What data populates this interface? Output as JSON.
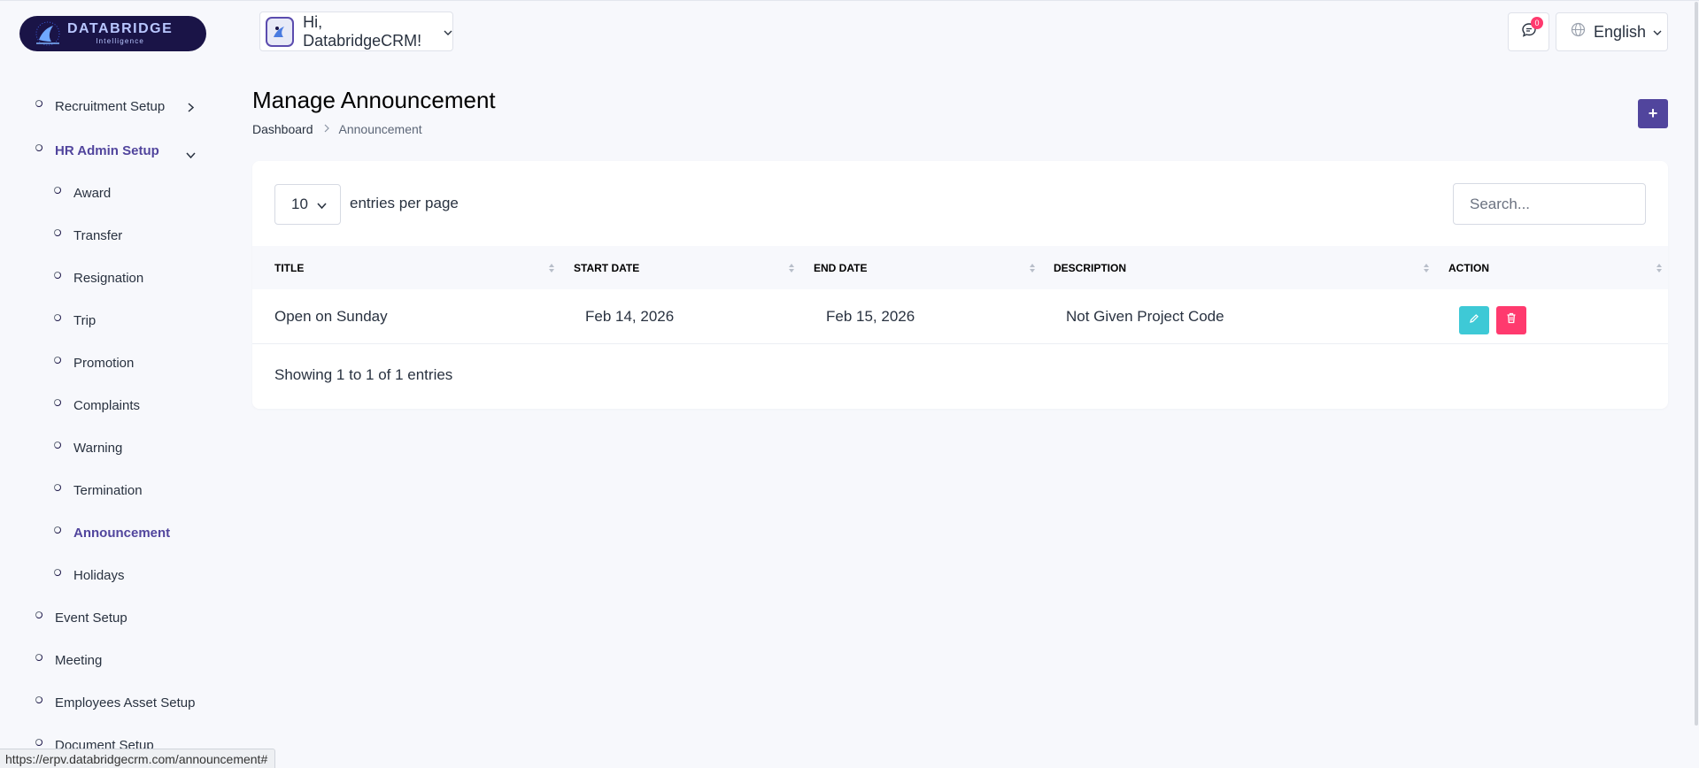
{
  "header": {
    "logo": {
      "title": "DATABRIDGE",
      "subtitle": "Intelligence"
    },
    "user_greeting": "Hi, DatabridgeCRM!",
    "notification_count": "0",
    "language": "English"
  },
  "sidebar": {
    "items": [
      {
        "label": "Recruitment Setup",
        "level": 1,
        "expandable": true,
        "expanded": false
      },
      {
        "label": "HR Admin Setup",
        "level": 1,
        "expandable": true,
        "expanded": true,
        "active": true
      },
      {
        "label": "Award",
        "level": 2
      },
      {
        "label": "Transfer",
        "level": 2
      },
      {
        "label": "Resignation",
        "level": 2
      },
      {
        "label": "Trip",
        "level": 2
      },
      {
        "label": "Promotion",
        "level": 2
      },
      {
        "label": "Complaints",
        "level": 2
      },
      {
        "label": "Warning",
        "level": 2
      },
      {
        "label": "Termination",
        "level": 2
      },
      {
        "label": "Announcement",
        "level": 2,
        "active": true
      },
      {
        "label": "Holidays",
        "level": 2
      },
      {
        "label": "Event Setup",
        "level": 1
      },
      {
        "label": "Meeting",
        "level": 1
      },
      {
        "label": "Employees Asset Setup",
        "level": 1
      },
      {
        "label": "Document Setup",
        "level": 1
      }
    ]
  },
  "main": {
    "title": "Manage Announcement",
    "breadcrumb": {
      "home": "Dashboard",
      "current": "Announcement"
    },
    "add_button": "+",
    "table": {
      "per_page": "10",
      "per_page_label": "entries per page",
      "search_placeholder": "Search...",
      "columns": [
        "TITLE",
        "START DATE",
        "END DATE",
        "DESCRIPTION",
        "ACTION"
      ],
      "rows": [
        {
          "title": "Open on Sunday",
          "start_date": "Feb 14, 2026",
          "end_date": "Feb 15, 2026",
          "description": "Not Given Project Code"
        }
      ],
      "footer_info": "Showing 1 to 1 of 1 entries"
    }
  },
  "status_bar": {
    "url": "https://erpv.databridgecrm.com/announcement#"
  },
  "colors": {
    "accent": "#51459d",
    "edit": "#3ec9d6",
    "delete": "#ff3a6e",
    "background": "#f7f8fc"
  }
}
